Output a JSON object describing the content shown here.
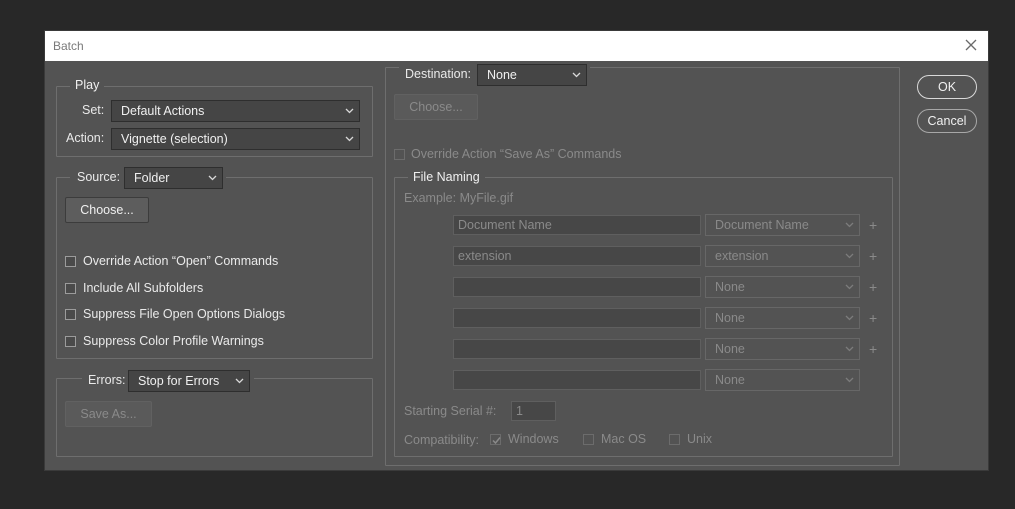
{
  "window": {
    "title": "Batch"
  },
  "play": {
    "legend": "Play",
    "set_label": "Set:",
    "set_value": "Default Actions",
    "action_label": "Action:",
    "action_value": "Vignette (selection)"
  },
  "source": {
    "label": "Source:",
    "value": "Folder",
    "choose_label": "Choose...",
    "options": [
      {
        "label": "Override Action “Open” Commands",
        "checked": false
      },
      {
        "label": "Include All Subfolders",
        "checked": false
      },
      {
        "label": "Suppress File Open Options Dialogs",
        "checked": false
      },
      {
        "label": "Suppress Color Profile Warnings",
        "checked": false
      }
    ]
  },
  "errors": {
    "label": "Errors:",
    "value": "Stop for Errors",
    "save_as_label": "Save As..."
  },
  "destination": {
    "label": "Destination:",
    "value": "None",
    "choose_label": "Choose...",
    "override_label": "Override Action “Save As” Commands"
  },
  "file_naming": {
    "legend": "File Naming",
    "example": "Example: MyFile.gif",
    "rows": [
      {
        "field": "Document Name",
        "select": "Document Name",
        "plus": "+"
      },
      {
        "field": "extension",
        "select": "extension",
        "plus": "+"
      },
      {
        "field": "",
        "select": "None",
        "plus": "+"
      },
      {
        "field": "",
        "select": "None",
        "plus": "+"
      },
      {
        "field": "",
        "select": "None",
        "plus": "+"
      },
      {
        "field": "",
        "select": "None",
        "plus": ""
      }
    ],
    "serial_label": "Starting Serial #:",
    "serial_value": "1",
    "compat_label": "Compatibility:",
    "compat": [
      {
        "label": "Windows",
        "checked": true
      },
      {
        "label": "Mac OS",
        "checked": false
      },
      {
        "label": "Unix",
        "checked": false
      }
    ]
  },
  "buttons": {
    "ok": "OK",
    "cancel": "Cancel"
  },
  "colors": {
    "dialog_bg": "#535353",
    "page_bg": "#282828",
    "disabled_text": "#8a8a8a"
  }
}
